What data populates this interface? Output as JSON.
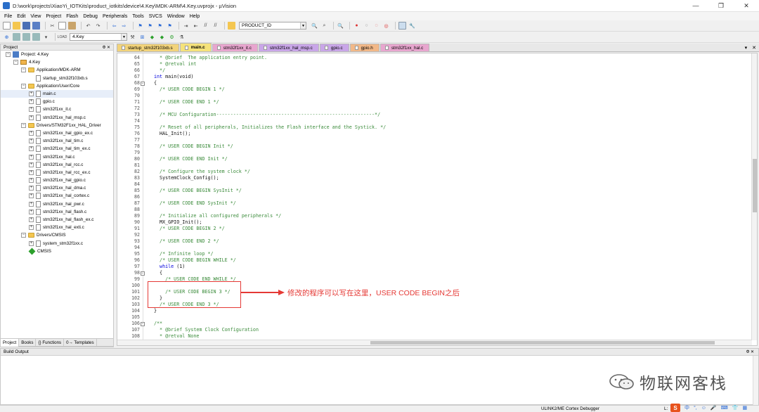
{
  "window": {
    "title": "D:\\work\\projects\\XiaoYi_IOTKits\\product_iotkits\\device\\4.Key\\MDK-ARM\\4.Key.uvprojx - µVision",
    "minimize": "—",
    "maximize": "❐",
    "close": "✕"
  },
  "menu": [
    "File",
    "Edit",
    "View",
    "Project",
    "Flash",
    "Debug",
    "Peripherals",
    "Tools",
    "SVCS",
    "Window",
    "Help"
  ],
  "toolbar": {
    "find_combo_value": "PRODUCT_ID",
    "target_combo_value": "4.Key",
    "icons": [
      "new-file-icon",
      "open-icon",
      "save-icon",
      "save-all-icon",
      "cut-icon",
      "copy-icon",
      "paste-icon",
      "undo-icon",
      "redo-icon",
      "back-icon",
      "forward-icon",
      "bookmark-icon",
      "indent-icon",
      "comment-icon",
      "find-icon",
      "debug-start-icon",
      "breakpoint-icon",
      "settings-icon"
    ]
  },
  "project_panel": {
    "title": "Project",
    "pin": "Ф ✕",
    "tree": [
      {
        "label": "Project: 4.Key",
        "level": 0,
        "type": "project",
        "exp": "−"
      },
      {
        "label": "4.Key",
        "level": 1,
        "type": "target",
        "exp": "−"
      },
      {
        "label": "Application/MDK-ARM",
        "level": 2,
        "type": "folder",
        "exp": "−"
      },
      {
        "label": "startup_stm32f103xb.s",
        "level": 3,
        "type": "file",
        "exp": ""
      },
      {
        "label": "Application/User/Core",
        "level": 2,
        "type": "folder",
        "exp": "−"
      },
      {
        "label": "main.c",
        "level": 3,
        "type": "file",
        "exp": "+"
      },
      {
        "label": "gpio.c",
        "level": 3,
        "type": "file",
        "exp": "+"
      },
      {
        "label": "stm32f1xx_it.c",
        "level": 3,
        "type": "file",
        "exp": "+"
      },
      {
        "label": "stm32f1xx_hal_msp.c",
        "level": 3,
        "type": "file",
        "exp": "+"
      },
      {
        "label": "Drivers/STM32F1xx_HAL_Driver",
        "level": 2,
        "type": "folder",
        "exp": "−"
      },
      {
        "label": "stm32f1xx_hal_gpio_ex.c",
        "level": 3,
        "type": "file",
        "exp": "+"
      },
      {
        "label": "stm32f1xx_hal_tim.c",
        "level": 3,
        "type": "file",
        "exp": "+"
      },
      {
        "label": "stm32f1xx_hal_tim_ex.c",
        "level": 3,
        "type": "file",
        "exp": "+"
      },
      {
        "label": "stm32f1xx_hal.c",
        "level": 3,
        "type": "file",
        "exp": "+"
      },
      {
        "label": "stm32f1xx_hal_rcc.c",
        "level": 3,
        "type": "file",
        "exp": "+"
      },
      {
        "label": "stm32f1xx_hal_rcc_ex.c",
        "level": 3,
        "type": "file",
        "exp": "+"
      },
      {
        "label": "stm32f1xx_hal_gpio.c",
        "level": 3,
        "type": "file",
        "exp": "+"
      },
      {
        "label": "stm32f1xx_hal_dma.c",
        "level": 3,
        "type": "file",
        "exp": "+"
      },
      {
        "label": "stm32f1xx_hal_cortex.c",
        "level": 3,
        "type": "file",
        "exp": "+"
      },
      {
        "label": "stm32f1xx_hal_pwr.c",
        "level": 3,
        "type": "file",
        "exp": "+"
      },
      {
        "label": "stm32f1xx_hal_flash.c",
        "level": 3,
        "type": "file",
        "exp": "+"
      },
      {
        "label": "stm32f1xx_hal_flash_ex.c",
        "level": 3,
        "type": "file",
        "exp": "+"
      },
      {
        "label": "stm32f1xx_hal_exti.c",
        "level": 3,
        "type": "file",
        "exp": "+"
      },
      {
        "label": "Drivers/CMSIS",
        "level": 2,
        "type": "folder",
        "exp": "−"
      },
      {
        "label": "system_stm32f1xx.c",
        "level": 3,
        "type": "file",
        "exp": "+"
      },
      {
        "label": "CMSIS",
        "level": 2,
        "type": "cmsis",
        "exp": ""
      }
    ],
    "tabs": [
      "Project",
      "Books",
      "{} Functions",
      "0→ Templates"
    ]
  },
  "editor_tabs": [
    {
      "label": "startup_stm32f103xb.s",
      "color": "#f2d37a",
      "active": false
    },
    {
      "label": "main.c",
      "color": "#f5e27a",
      "active": true
    },
    {
      "label": "stm32f1xx_it.c",
      "color": "#e8a6cf",
      "active": false
    },
    {
      "label": "stm32f1xx_hal_msp.c",
      "color": "#c9a6e8",
      "active": false
    },
    {
      "label": "gpio.c",
      "color": "#c9a6e8",
      "active": false
    },
    {
      "label": "gpio.h",
      "color": "#f2b888",
      "active": false
    },
    {
      "label": "stm32f1xx_hal.c",
      "color": "#e8a6cf",
      "active": false
    }
  ],
  "editor_tab_controls": [
    "▾",
    "✕"
  ],
  "code_lines": [
    {
      "n": "64",
      "text": "  * @brief  The application entry point.",
      "kind": "comment",
      "fold": ""
    },
    {
      "n": "65",
      "text": "  * @retval int",
      "kind": "comment",
      "fold": ""
    },
    {
      "n": "66",
      "text": "  */",
      "kind": "comment",
      "fold": ""
    },
    {
      "n": "67",
      "text": "int main(void)",
      "kind": "keyword-mixed",
      "fold": ""
    },
    {
      "n": "68",
      "text": "{",
      "kind": "plain",
      "fold": "−"
    },
    {
      "n": "69",
      "text": "  /* USER CODE BEGIN 1 */",
      "kind": "comment",
      "fold": ""
    },
    {
      "n": "70",
      "text": "",
      "kind": "plain",
      "fold": ""
    },
    {
      "n": "71",
      "text": "  /* USER CODE END 1 */",
      "kind": "comment",
      "fold": ""
    },
    {
      "n": "72",
      "text": "",
      "kind": "plain",
      "fold": ""
    },
    {
      "n": "73",
      "text": "  /* MCU Configuration--------------------------------------------------------*/",
      "kind": "comment",
      "fold": ""
    },
    {
      "n": "74",
      "text": "",
      "kind": "plain",
      "fold": ""
    },
    {
      "n": "75",
      "text": "  /* Reset of all peripherals, Initializes the Flash interface and the Systick. */",
      "kind": "comment",
      "fold": ""
    },
    {
      "n": "76",
      "text": "  HAL_Init();",
      "kind": "plain",
      "fold": ""
    },
    {
      "n": "77",
      "text": "",
      "kind": "plain",
      "fold": ""
    },
    {
      "n": "78",
      "text": "  /* USER CODE BEGIN Init */",
      "kind": "comment",
      "fold": ""
    },
    {
      "n": "79",
      "text": "",
      "kind": "plain",
      "fold": ""
    },
    {
      "n": "80",
      "text": "  /* USER CODE END Init */",
      "kind": "comment",
      "fold": ""
    },
    {
      "n": "81",
      "text": "",
      "kind": "plain",
      "fold": ""
    },
    {
      "n": "82",
      "text": "  /* Configure the system clock */",
      "kind": "comment",
      "fold": ""
    },
    {
      "n": "83",
      "text": "  SystemClock_Config();",
      "kind": "plain",
      "fold": ""
    },
    {
      "n": "84",
      "text": "",
      "kind": "plain",
      "fold": ""
    },
    {
      "n": "85",
      "text": "  /* USER CODE BEGIN SysInit */",
      "kind": "comment",
      "fold": ""
    },
    {
      "n": "86",
      "text": "",
      "kind": "plain",
      "fold": ""
    },
    {
      "n": "87",
      "text": "  /* USER CODE END SysInit */",
      "kind": "comment",
      "fold": ""
    },
    {
      "n": "88",
      "text": "",
      "kind": "plain",
      "fold": ""
    },
    {
      "n": "89",
      "text": "  /* Initialize all configured peripherals */",
      "kind": "comment",
      "fold": ""
    },
    {
      "n": "90",
      "text": "  MX_GPIO_Init();",
      "kind": "plain",
      "fold": ""
    },
    {
      "n": "91",
      "text": "  /* USER CODE BEGIN 2 */",
      "kind": "comment",
      "fold": ""
    },
    {
      "n": "92",
      "text": "",
      "kind": "plain",
      "fold": ""
    },
    {
      "n": "93",
      "text": "  /* USER CODE END 2 */",
      "kind": "comment",
      "fold": ""
    },
    {
      "n": "94",
      "text": "",
      "kind": "plain",
      "fold": ""
    },
    {
      "n": "95",
      "text": "  /* Infinite loop */",
      "kind": "comment",
      "fold": ""
    },
    {
      "n": "96",
      "text": "  /* USER CODE BEGIN WHILE */",
      "kind": "comment",
      "fold": ""
    },
    {
      "n": "97",
      "text": "  while (1)",
      "kind": "keyword-mixed",
      "fold": ""
    },
    {
      "n": "98",
      "text": "  {",
      "kind": "plain",
      "fold": "−"
    },
    {
      "n": "99",
      "text": "    /* USER CODE END WHILE */",
      "kind": "comment",
      "fold": ""
    },
    {
      "n": "100",
      "text": "",
      "kind": "plain",
      "fold": ""
    },
    {
      "n": "101",
      "text": "    /* USER CODE BEGIN 3 */",
      "kind": "comment",
      "fold": ""
    },
    {
      "n": "102",
      "text": "  }",
      "kind": "plain",
      "fold": ""
    },
    {
      "n": "103",
      "text": "  /* USER CODE END 3 */",
      "kind": "comment",
      "fold": ""
    },
    {
      "n": "104",
      "text": "}",
      "kind": "plain",
      "fold": ""
    },
    {
      "n": "105",
      "text": "",
      "kind": "plain",
      "fold": ""
    },
    {
      "n": "106",
      "text": "/**",
      "kind": "comment",
      "fold": "−"
    },
    {
      "n": "107",
      "text": "  * @brief System Clock Configuration",
      "kind": "comment",
      "fold": ""
    },
    {
      "n": "108",
      "text": "  * @retval None",
      "kind": "comment",
      "fold": ""
    }
  ],
  "annotation": {
    "text": "修改的程序可以写在这里，USER CODE  BEGIN之后",
    "color": "#e53935"
  },
  "build_output": {
    "title": "Build Output",
    "pin": "Ф ✕"
  },
  "watermark": {
    "text": "物联网客栈"
  },
  "statusbar": {
    "debugger": "ULINK2/ME Cortex Debugger",
    "cursor": "L:",
    "ime_logo": "S",
    "ime_items": [
      "中",
      "°,",
      "☺",
      "🎤",
      "⌨",
      "👕",
      "▦"
    ]
  },
  "colors": {
    "comment": "#3c8c3c",
    "keyword": "#0000dd",
    "annotation_red": "#e53935"
  }
}
